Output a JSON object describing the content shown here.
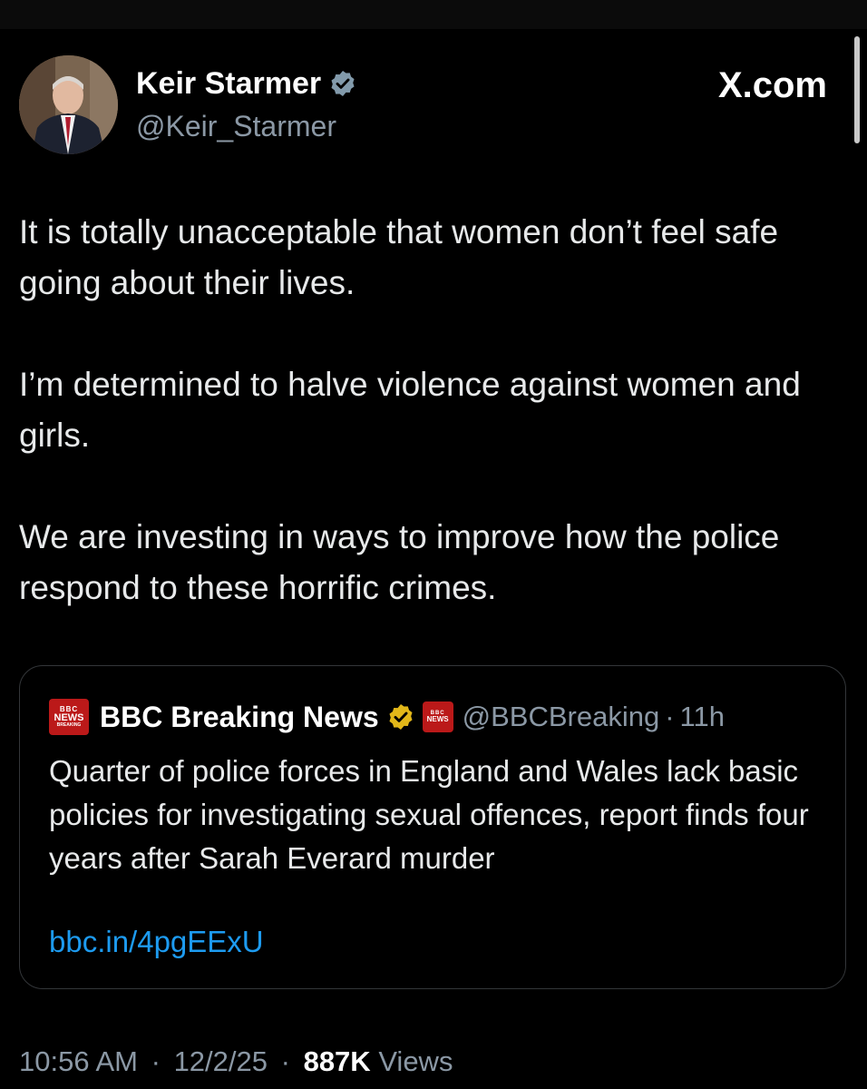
{
  "author": {
    "name": "Keir Starmer",
    "handle": "@Keir_Starmer"
  },
  "site_logo": "X.com",
  "tweet": {
    "paragraphs": [
      "It is totally unacceptable that women don’t feel safe going about their lives.",
      "I’m determined to halve violence against women and girls.",
      "We are investing in ways to improve how the police respond to these horrific crimes."
    ]
  },
  "quoted": {
    "badge": {
      "line1": "BBC",
      "line2": "NEWS",
      "line3": "BREAKING"
    },
    "name": "BBC Breaking News",
    "handle": "@BBCBreaking",
    "dot": "·",
    "time": "11h",
    "text": "Quarter of police forces in England and Wales lack basic policies for investigating sexual offences, report finds four years after Sarah Everard murder",
    "link": "bbc.in/4pgEExU"
  },
  "meta": {
    "time": "10:56 AM",
    "sep": "·",
    "date": "12/2/25",
    "views_count": "887K",
    "views_label": "Views"
  },
  "colors": {
    "background": "#000000",
    "text": "#e7e9ea",
    "secondary": "#8b98a5",
    "link": "#1d9bf0",
    "verified_blue": "#829aab",
    "verified_gold": "#e2b719",
    "bbc_red": "#bb1919"
  },
  "icons": {
    "verified": "verified-badge-icon",
    "gold_verified": "gold-verified-badge-icon",
    "x_logo": "x-logo-icon"
  }
}
